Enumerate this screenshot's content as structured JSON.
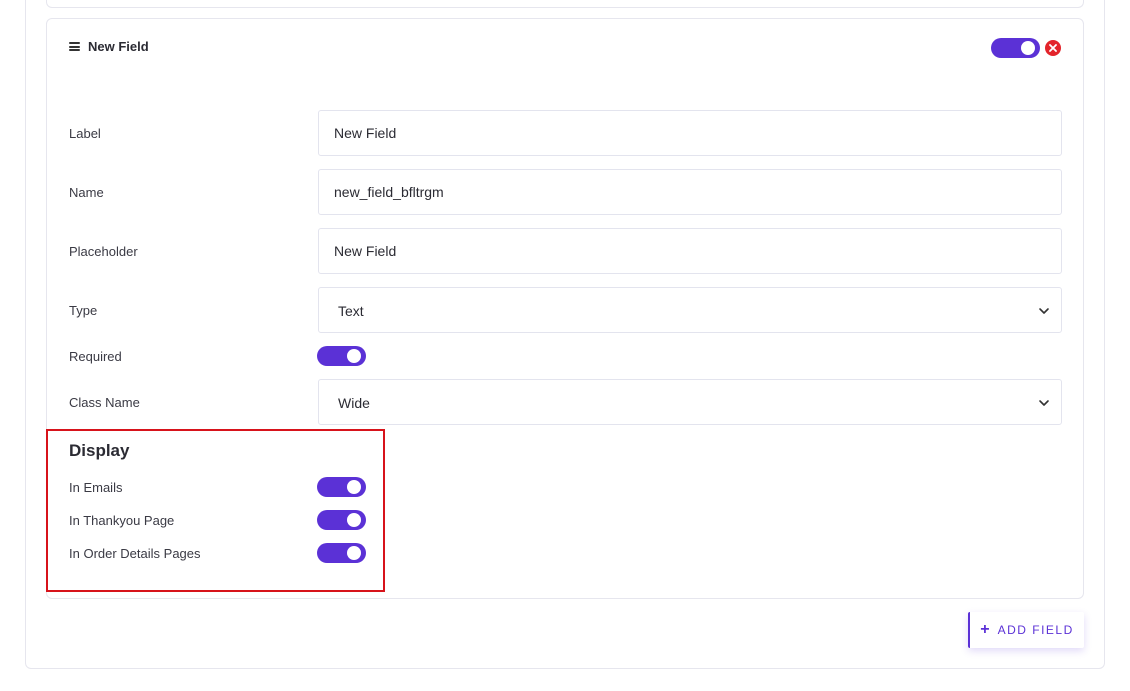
{
  "field": {
    "title": "New Field",
    "enabled": true,
    "label": {
      "label": "Label",
      "value": "New Field"
    },
    "name": {
      "label": "Name",
      "value": "new_field_bfltrgm"
    },
    "placeholder": {
      "label": "Placeholder",
      "value": "New Field"
    },
    "type": {
      "label": "Type",
      "value": "Text"
    },
    "required": {
      "label": "Required",
      "value": true
    },
    "class_name": {
      "label": "Class Name",
      "value": "Wide"
    }
  },
  "display": {
    "title": "Display",
    "items": [
      {
        "label": "In Emails",
        "value": true
      },
      {
        "label": "In Thankyou Page",
        "value": true
      },
      {
        "label": "In Order Details Pages",
        "value": true
      }
    ]
  },
  "add_field_button": {
    "label": "ADD FIELD",
    "icon": "plus-icon"
  },
  "colors": {
    "accent": "#5b31d6",
    "danger": "#e3242b",
    "highlight": "#d7131b"
  }
}
